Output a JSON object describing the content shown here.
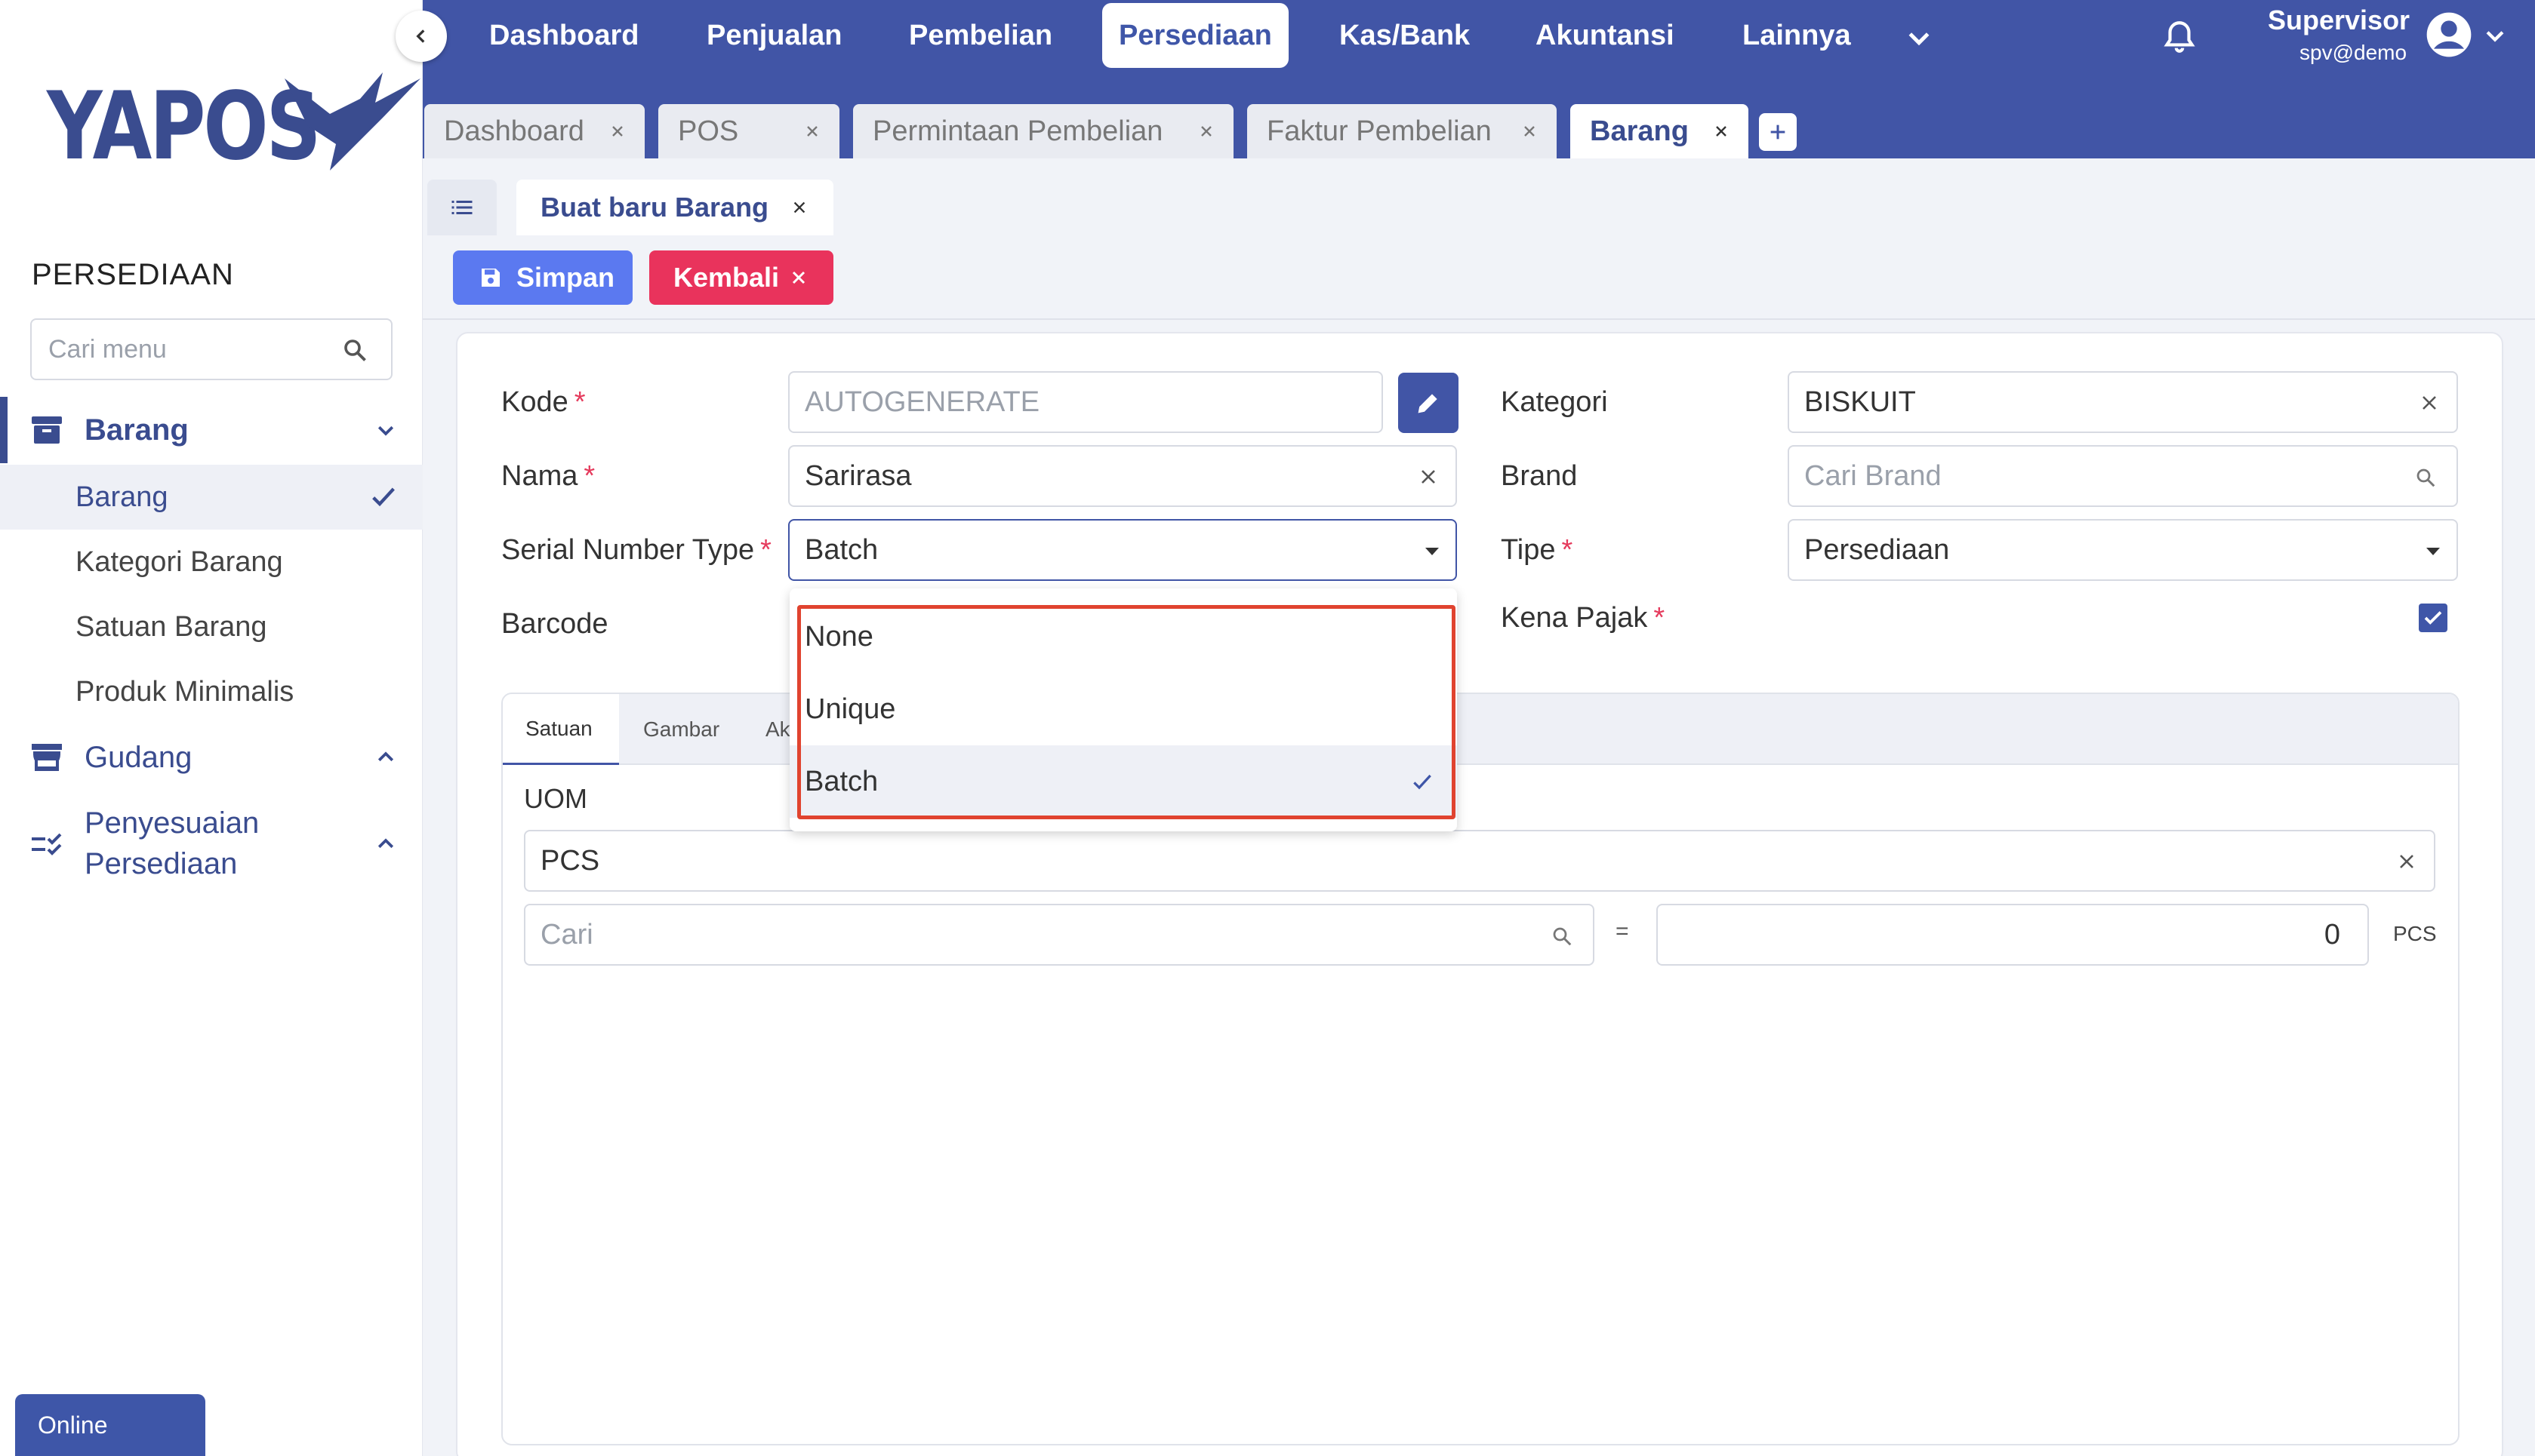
{
  "brand": {
    "name": "YAPOS"
  },
  "sidebar": {
    "title": "PERSEDIAAN",
    "search_placeholder": "Cari menu",
    "groups": [
      {
        "label": "Barang",
        "icon": "archive-icon",
        "expanded": true,
        "items": [
          {
            "label": "Barang",
            "active": true
          },
          {
            "label": "Kategori Barang"
          },
          {
            "label": "Satuan Barang"
          },
          {
            "label": "Produk Minimalis"
          }
        ]
      },
      {
        "label": "Gudang",
        "icon": "warehouse-icon",
        "expanded": false
      },
      {
        "label_line1": "Penyesuaian",
        "label_line2": "Persediaan",
        "icon": "checklist-icon",
        "expanded": false
      }
    ],
    "status": "Online"
  },
  "topnav": {
    "items": [
      "Dashboard",
      "Penjualan",
      "Pembelian",
      "Persediaan",
      "Kas/Bank",
      "Akuntansi",
      "Lainnya"
    ],
    "active": "Persediaan",
    "user": {
      "name": "Supervisor",
      "sub": "spv@demo"
    }
  },
  "tabs": [
    "Dashboard",
    "POS",
    "Permintaan Pembelian",
    "Faktur Pembelian",
    "Barang"
  ],
  "active_tab": "Barang",
  "subtab": {
    "label": "Buat baru Barang"
  },
  "toolbar": {
    "save_label": "Simpan",
    "back_label": "Kembali"
  },
  "form": {
    "kode": {
      "label": "Kode",
      "placeholder": "AUTOGENERATE"
    },
    "nama": {
      "label": "Nama",
      "value": "Sarirasa"
    },
    "serial_number_type": {
      "label": "Serial Number Type",
      "value": "Batch",
      "options": [
        "None",
        "Unique",
        "Batch"
      ]
    },
    "barcode": {
      "label": "Barcode"
    },
    "kategori": {
      "label": "Kategori",
      "value": "BISKUIT"
    },
    "brand": {
      "label": "Brand",
      "placeholder": "Cari Brand"
    },
    "tipe": {
      "label": "Tipe",
      "value": "Persediaan"
    },
    "kena_pajak": {
      "label": "Kena Pajak",
      "checked": true
    }
  },
  "panel": {
    "tabs": [
      "Satuan",
      "Gambar",
      "Ak"
    ],
    "active_tab": "Satuan",
    "uom_label": "UOM",
    "uom_value": "PCS",
    "search_placeholder": "Cari",
    "equals": "=",
    "qty_value": "0",
    "unit": "PCS"
  },
  "colors": {
    "primary": "#4155a6",
    "save": "#5b79f0",
    "danger": "#e9335c",
    "highlight": "#e0432f"
  }
}
